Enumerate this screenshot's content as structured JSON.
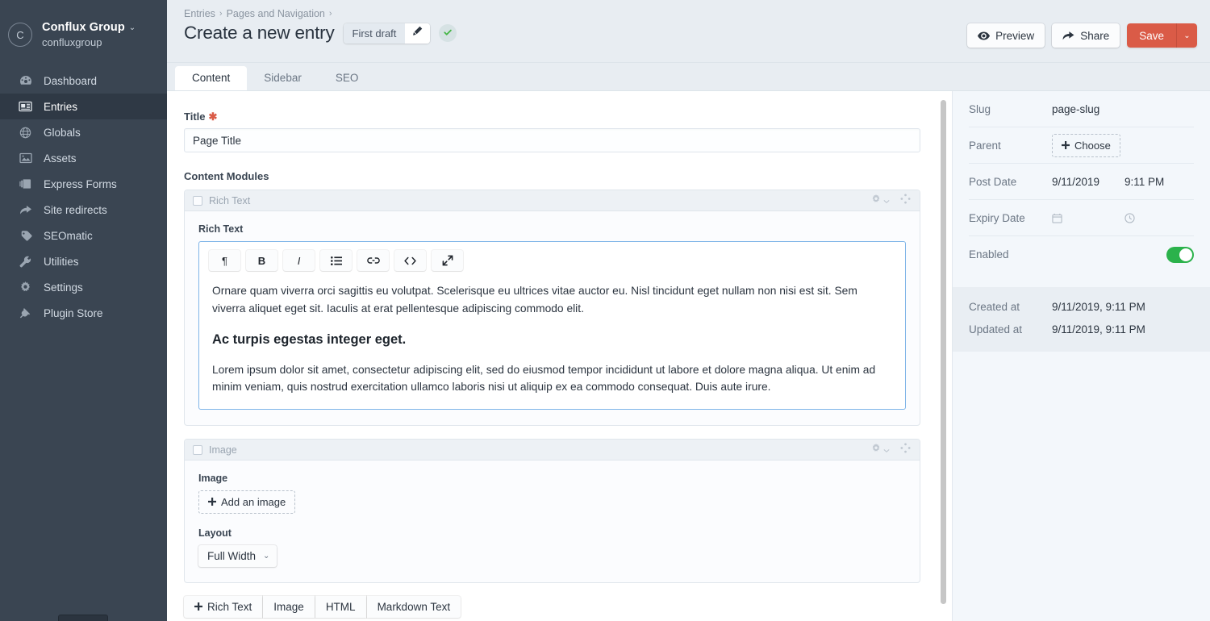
{
  "sidebar": {
    "brand": {
      "initial": "C",
      "name": "Conflux Group",
      "caret": "⌄",
      "handle": "confluxgroup"
    },
    "items": [
      {
        "label": "Dashboard",
        "icon": "gauge-icon"
      },
      {
        "label": "Entries",
        "icon": "entries-icon"
      },
      {
        "label": "Globals",
        "icon": "globe-icon"
      },
      {
        "label": "Assets",
        "icon": "image-icon"
      },
      {
        "label": "Express Forms",
        "icon": "forms-icon"
      },
      {
        "label": "Site redirects",
        "icon": "arrow-redirect-icon"
      },
      {
        "label": "SEOmatic",
        "icon": "tag-icon"
      },
      {
        "label": "Utilities",
        "icon": "wrench-icon"
      },
      {
        "label": "Settings",
        "icon": "gear-icon"
      },
      {
        "label": "Plugin Store",
        "icon": "plug-icon"
      }
    ]
  },
  "topbar": {
    "breadcrumb": [
      "Entries",
      "Pages and Navigation"
    ],
    "separator": "›",
    "title": "Create a new entry",
    "draft_label": "First draft",
    "preview_label": "Preview",
    "share_label": "Share",
    "save_label": "Save",
    "save_caret": "⌄"
  },
  "tabs": [
    {
      "label": "Content",
      "active": true
    },
    {
      "label": "Sidebar",
      "active": false
    },
    {
      "label": "SEO",
      "active": false
    }
  ],
  "content": {
    "title_field": {
      "label": "Title",
      "required_mark": "✱",
      "value": "Page Title"
    },
    "content_modules_label": "Content Modules",
    "blocks": [
      {
        "type_label": "Rich Text",
        "field_label": "Rich Text",
        "toolbar": [
          "¶",
          "B",
          "I",
          "list-icon",
          "link-icon",
          "code-icon",
          "expand-icon"
        ],
        "paragraphs": [
          "Ornare quam viverra orci sagittis eu volutpat. Scelerisque eu ultrices vitae auctor eu. Nisl tincidunt eget nullam non nisi est sit. Sem viverra aliquet eget sit. Iaculis at erat pellentesque adipiscing commodo elit.",
          "Lorem ipsum dolor sit amet, consectetur adipiscing elit, sed do eiusmod tempor incididunt ut labore et dolore magna aliqua. Ut enim ad minim veniam, quis nostrud exercitation ullamco laboris nisi ut aliquip ex ea commodo consequat. Duis aute irure."
        ],
        "heading": "Ac turpis egestas integer eget."
      },
      {
        "type_label": "Image",
        "image_label": "Image",
        "add_image_label": "Add an image",
        "layout_label": "Layout",
        "layout_value": "Full Width",
        "layout_caret": "⌄"
      }
    ],
    "add_buttons": [
      "Rich Text",
      "Image",
      "HTML",
      "Markdown Text"
    ],
    "add_plus": "＋"
  },
  "meta": {
    "rows": [
      {
        "key": "Slug",
        "value": "page-slug"
      },
      {
        "key": "Parent",
        "choose_label": "Choose"
      },
      {
        "key": "Post Date",
        "date": "9/11/2019",
        "time": "9:11 PM"
      },
      {
        "key": "Expiry Date",
        "date": "",
        "time": ""
      },
      {
        "key": "Enabled",
        "toggle": true
      }
    ],
    "footer": [
      {
        "key": "Created at",
        "value": "9/11/2019, 9:11 PM"
      },
      {
        "key": "Updated at",
        "value": "9/11/2019, 9:11 PM"
      }
    ]
  },
  "colors": {
    "sidebar_bg": "#3a4552",
    "accent_red": "#da5b47",
    "toggle_green": "#2bb24b",
    "focus_blue": "#7fb5e8",
    "topbar_bg": "#e8edf2"
  }
}
